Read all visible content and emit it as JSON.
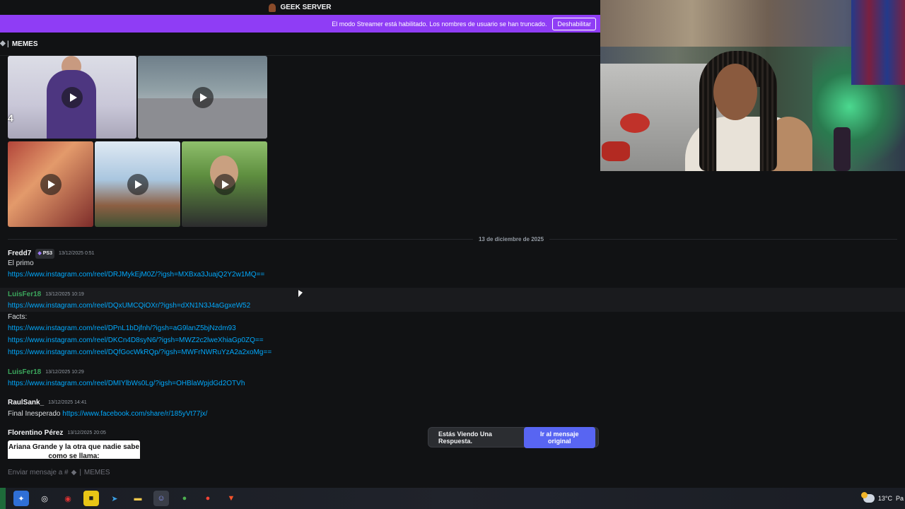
{
  "server_bar": {
    "name": "GEEK SERVER"
  },
  "streamer_banner": {
    "message": "El modo Streamer está habilitado. Los nombres de usuario se han truncado.",
    "button": "Deshabilitar"
  },
  "channel": {
    "separator": "|",
    "name": "MEMES"
  },
  "media": {
    "overflow_count": "4"
  },
  "date_divider": "13 de diciembre de 2025",
  "messages": [
    {
      "author": "Fredd7",
      "tag": "PS3",
      "timestamp": "13/12/2025 0:51",
      "text": "El primo",
      "links": [
        "https://www.instagram.com/reel/DRJMykEjM0Z/?igsh=MXBxa3JuajQ2Y2w1MQ=="
      ]
    },
    {
      "author": "LuisFer18",
      "timestamp": "13/12/2025 10:19",
      "links": [
        "https://www.instagram.com/reel/DQxUMCQiOXr/?igsh=dXN1N3J4aGgxeW52"
      ],
      "text2": "Facts:",
      "links2": [
        "https://www.instagram.com/reel/DPnL1bDjfnh/?igsh=aG9lanZ5bjNzdm93",
        "https://www.instagram.com/reel/DKCn4D8syN6/?igsh=MWZ2c2lweXhiaGp0ZQ==",
        "https://www.instagram.com/reel/DQfGocWkRQp/?igsh=MWFrNWRuYzA2a2xoMg=="
      ]
    },
    {
      "author": "LuisFer18",
      "timestamp": "13/12/2025 10:29",
      "links": [
        "https://www.instagram.com/reel/DMIYlbWs0Lg/?igsh=OHBlaWpjdGd2OTVh"
      ]
    },
    {
      "author": "RaulSank_",
      "timestamp": "13/12/2025 14:41",
      "text": "Final Inesperado",
      "link": "https://www.facebook.com/share/r/185yVt77jx/"
    },
    {
      "author": "Florentino Pérez",
      "timestamp": "13/12/2025 20:05",
      "image_caption": "Ariana Grande y la otra que nadie sabe como se llama:"
    }
  ],
  "reply_toast": {
    "text": "Estás Viendo Una Respuesta.",
    "button": "Ir al mensaje original"
  },
  "composer": {
    "placeholder": "Enviar mensaje a #",
    "separator": "|",
    "channel": "MEMES"
  },
  "tray": {
    "temperature": "13°C",
    "extra": "Pa"
  },
  "colors": {
    "streamer_banner": "#8f3df5",
    "link": "#00a8fc",
    "accent_button": "#5865f2",
    "green_user": "#3ba55c"
  }
}
